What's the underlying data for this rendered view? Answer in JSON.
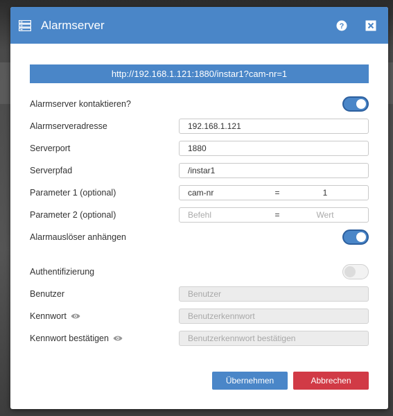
{
  "dialog": {
    "title": "Alarmserver",
    "icon": "server-icon",
    "help_icon": "help-icon",
    "close_icon": "close-icon"
  },
  "url": "http://192.168.1.121:1880/instar1?cam-nr=1",
  "fields": {
    "contact": {
      "label": "Alarmserver kontaktieren?",
      "toggle": true
    },
    "address": {
      "label": "Alarmserveradresse",
      "value": "192.168.1.121"
    },
    "port": {
      "label": "Serverport",
      "value": "1880"
    },
    "path": {
      "label": "Serverpfad",
      "value": "/instar1"
    },
    "param1": {
      "label": "Parameter 1 (optional)",
      "key": "cam-nr",
      "eq": "=",
      "value": "1"
    },
    "param2": {
      "label": "Parameter 2 (optional)",
      "key_placeholder": "Befehl",
      "eq": "=",
      "value_placeholder": "Wert"
    },
    "attach": {
      "label": "Alarmauslöser anhängen",
      "toggle": true
    },
    "auth": {
      "label": "Authentifizierung",
      "toggle": false
    },
    "user": {
      "label": "Benutzer",
      "placeholder": "Benutzer"
    },
    "password": {
      "label": "Kennwort",
      "placeholder": "Benutzerkennwort",
      "icon": "eye-icon"
    },
    "password_confirm": {
      "label": "Kennwort bestätigen",
      "placeholder": "Benutzerkennwort bestätigen",
      "icon": "eye-icon"
    }
  },
  "buttons": {
    "apply": "Übernehmen",
    "cancel": "Abbrechen"
  },
  "colors": {
    "primary": "#4a86c8",
    "danger": "#d13a46"
  }
}
